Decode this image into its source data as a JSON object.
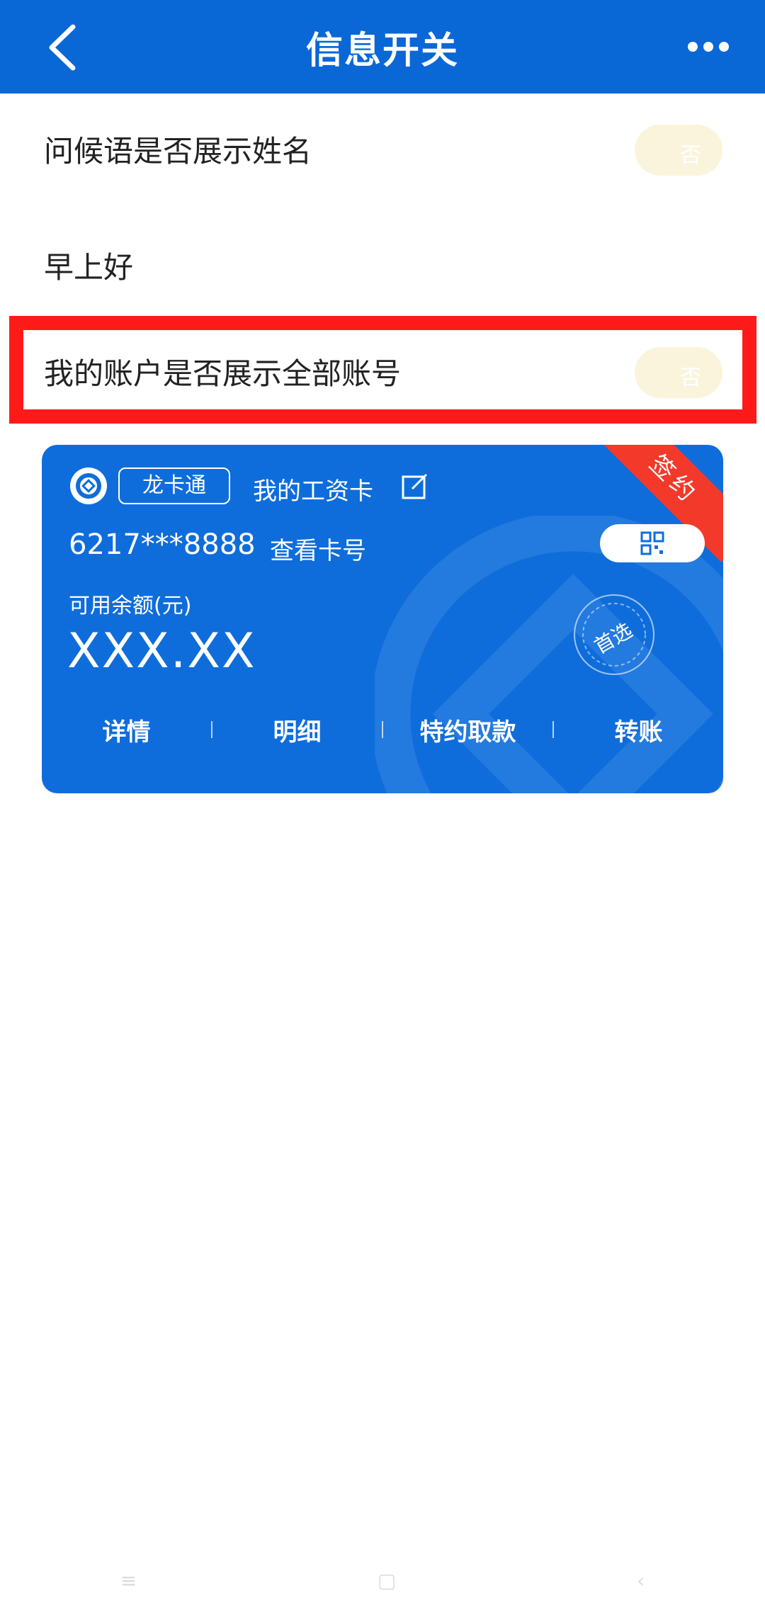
{
  "header": {
    "title": "信息开关",
    "back_icon": "chevron-left-icon",
    "more_icon": "more-dots-icon",
    "bg_color": "#0a67d6"
  },
  "settings": {
    "greeting_name": {
      "label": "问候语是否展示姓名",
      "toggle_text": "否",
      "state": "off"
    },
    "greeting_preview": "早上好",
    "show_all_accounts": {
      "label": "我的账户是否展示全部账号",
      "toggle_text": "否",
      "state": "off"
    }
  },
  "card": {
    "brand": "龙卡通",
    "name": "我的工资卡",
    "ribbon": "签约",
    "number": "6217***8888",
    "view_number_label": "查看卡号",
    "balance_label": "可用余额(元)",
    "balance_value": "XXX.XX",
    "preferred_stamp": "首选",
    "actions": [
      "详情",
      "明细",
      "特约取款",
      "转账"
    ],
    "color": "#0f6ddb",
    "ribbon_color": "#f2392a"
  },
  "highlight": {
    "color": "#ff1a1a"
  },
  "nav_hint": [
    "≡",
    "▢",
    "‹"
  ]
}
